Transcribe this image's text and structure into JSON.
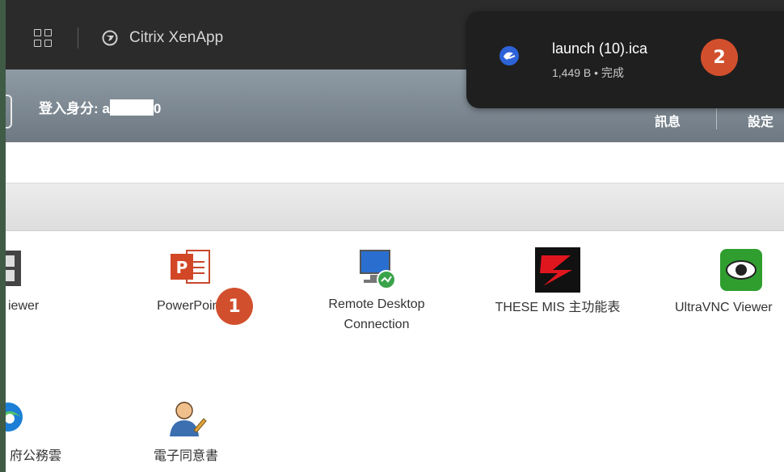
{
  "browser": {
    "tab_title": "Citrix XenApp"
  },
  "header": {
    "login_prefix": "登入身分: a",
    "login_suffix": "0",
    "nav": [
      "訊息",
      "設定"
    ]
  },
  "apps": [
    {
      "label": "iewer",
      "icon": "viewer-icon"
    },
    {
      "label": "PowerPoint",
      "icon": "powerpoint-icon"
    },
    {
      "label": "Remote Desktop Connection",
      "icon": "remote-desktop-icon"
    },
    {
      "label": "THESE MIS 主功能表",
      "icon": "these-mis-icon"
    },
    {
      "label": "UltraVNC Viewer",
      "icon": "ultravnc-eye-icon"
    },
    {
      "label": "府公務雲",
      "icon": "edge-browser-icon"
    },
    {
      "label": "電子同意書",
      "icon": "user-pen-icon"
    }
  ],
  "download": {
    "filename": "launch (10).ica",
    "status": "1,449 B • 完成",
    "icon": "citrix-receiver-icon"
  },
  "callouts": [
    "1",
    "2"
  ],
  "colors": {
    "callout": "#d24f2d",
    "tab_bar": "#2b2b2b",
    "header": "#7c8791"
  }
}
